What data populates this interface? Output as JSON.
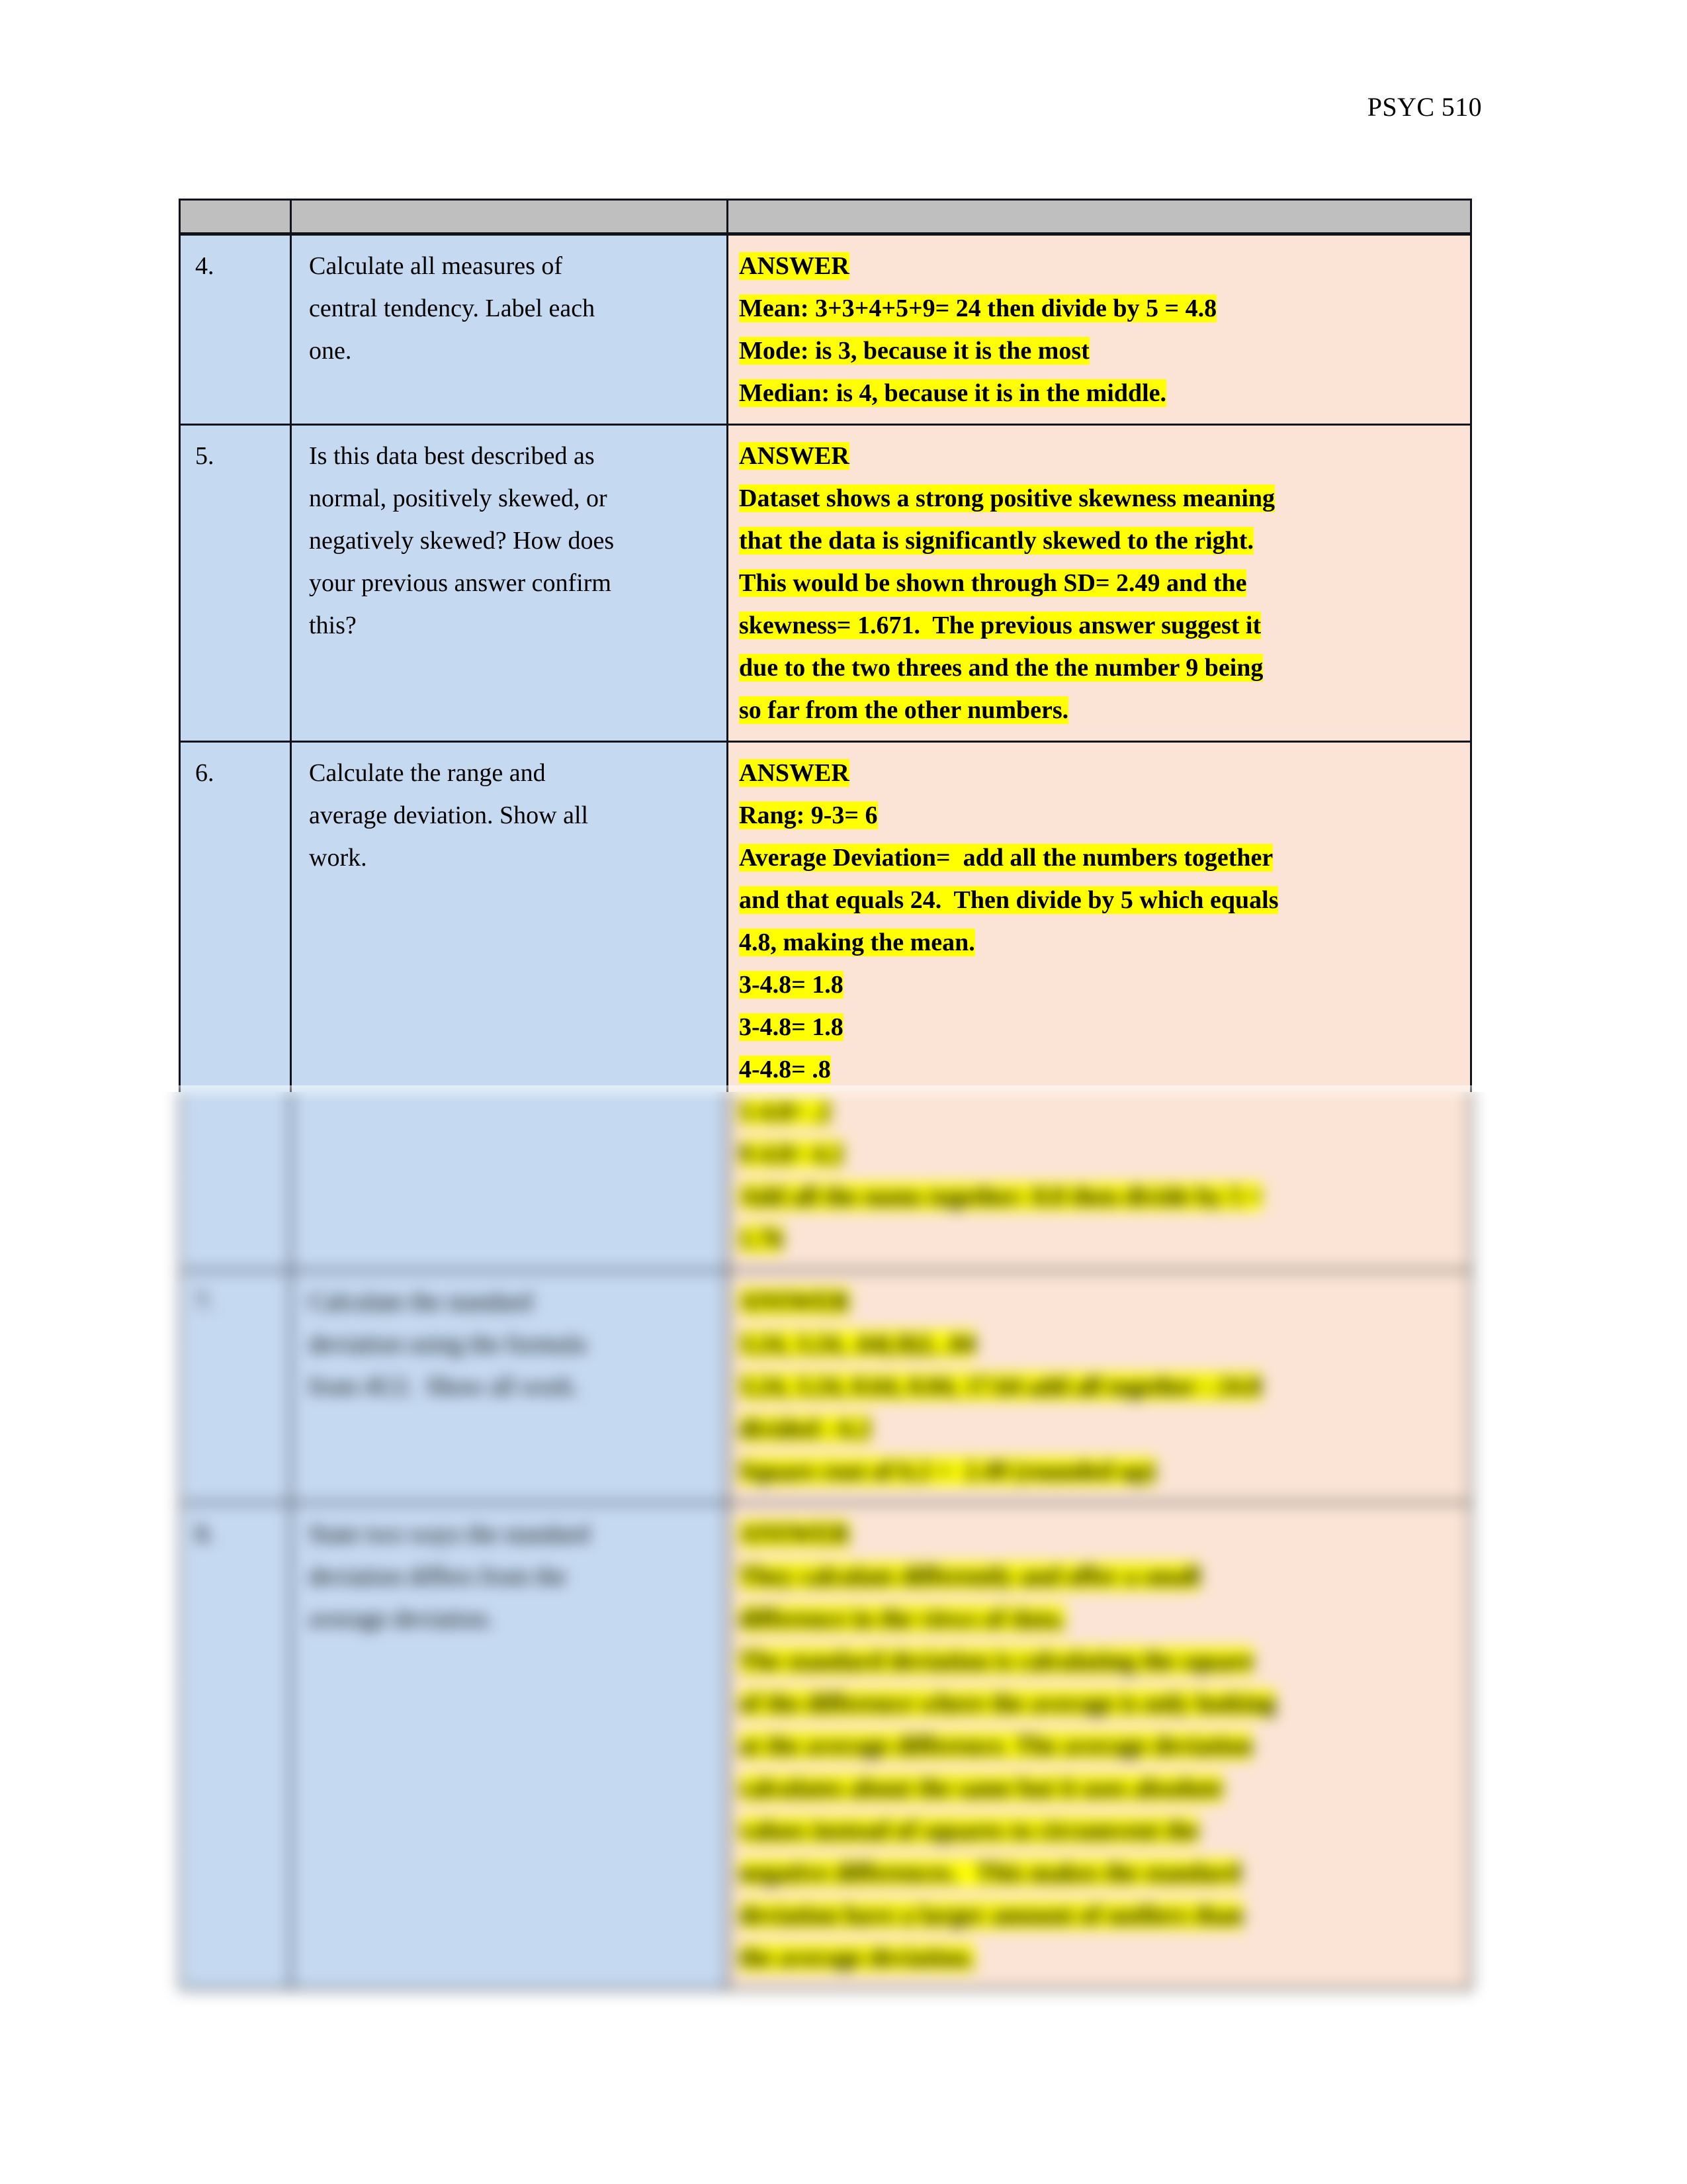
{
  "document": {
    "course_header": "PSYC 510"
  },
  "table": {
    "header_strip": "",
    "rows": [
      {
        "number": "4.",
        "question": [
          "Calculate all measures of",
          "central tendency. Label each",
          "one."
        ],
        "answer": [
          {
            "text": "ANSWER",
            "highlight": true
          },
          {
            "text": "Mean: 3+3+4+5+9= 24 then divide by 5 = 4.8",
            "highlight": true
          },
          {
            "text": "Mode: is 3, because it is the most",
            "highlight": true
          },
          {
            "text": "Median: is 4, because it is in the middle.",
            "highlight": true
          }
        ],
        "blurred": false
      },
      {
        "number": "5.",
        "question": [
          "Is this data best described as",
          "normal, positively skewed, or",
          "negatively skewed? How does",
          "your previous answer confirm",
          "this?"
        ],
        "answer": [
          {
            "text": "ANSWER",
            "highlight": true
          },
          {
            "text": "Dataset shows a strong positive skewness meaning",
            "highlight": true
          },
          {
            "text": "that the data is significantly skewed to the right.",
            "highlight": true
          },
          {
            "text": "This would be shown through SD= 2.49 and the",
            "highlight": true
          },
          {
            "text": "skewness= 1.671.  The previous answer suggest it",
            "highlight": true
          },
          {
            "text": "due to the two threes and the the number 9 being",
            "highlight": true
          },
          {
            "text": "so far from the other numbers.",
            "highlight": true
          }
        ],
        "blurred": false
      },
      {
        "number": "6.",
        "question": [
          "Calculate the range and",
          "average deviation. Show all",
          "work."
        ],
        "answer": [
          {
            "text": "ANSWER",
            "highlight": true
          },
          {
            "text": "Rang: 9-3= 6",
            "highlight": true
          },
          {
            "text": "Average Deviation=  add all the numbers together",
            "highlight": true
          },
          {
            "text": "and that equals 24.  Then divide by 5 which equals",
            "highlight": true
          },
          {
            "text": "4.8, making the mean.",
            "highlight": true
          },
          {
            "text": "3-4.8= 1.8",
            "highlight": true
          },
          {
            "text": "3-4.8= 1.8",
            "highlight": true
          },
          {
            "text": "4-4.8= .8",
            "highlight": true
          },
          {
            "text": "5-4.8= .2",
            "highlight": true
          },
          {
            "text": "9-4.8= 4.2",
            "highlight": true
          },
          {
            "text": "Add all the nums together: 8.8 then divide by 5 =",
            "highlight": true
          },
          {
            "text": "1.76",
            "highlight": true
          }
        ],
        "blurred": true
      },
      {
        "number": "7.",
        "question": [
          "Calculate the standard",
          "deviation using the formula",
          "from 4U2.  Show all work."
        ],
        "answer": [
          {
            "text": "ANSWER",
            "highlight": true
          },
          {
            "text": "3.24, 3.24, .64(.8)2, .04",
            "highlight": true
          },
          {
            "text": "3.24, 3.24, 0.64, 0.04, 17.64 add all together : 24.8",
            "highlight": true
          },
          {
            "text": "divided : 6.2",
            "highlight": true
          },
          {
            "text": "Square root of 6.2 =  2.49 (rounded up)",
            "highlight": true
          }
        ],
        "blurred": true
      },
      {
        "number": "8.",
        "question": [
          "State two ways the standard",
          "deviation differs from the",
          "average deviation."
        ],
        "answer": [
          {
            "text": "ANSWER",
            "highlight": true
          },
          {
            "text": "They calculate differently and offer a small",
            "highlight": true
          },
          {
            "text": "difference in the views of data.",
            "highlight": true
          },
          {
            "text": "The standard deviation is calculating the square",
            "highlight": true
          },
          {
            "text": "of the difference where the average is only looking",
            "highlight": true
          },
          {
            "text": "at the average difference. The average deviation",
            "highlight": true
          },
          {
            "text": "calculates about the same but it uses absolute",
            "highlight": true
          },
          {
            "text": "values instead of squares to circumvent the",
            "highlight": true
          },
          {
            "text": "negative differences.   This makes the standard",
            "highlight": true
          },
          {
            "text": "deviation have a larger amount of outliers than",
            "highlight": true
          },
          {
            "text": "the average deviation.",
            "highlight": true
          }
        ],
        "blurred": true
      }
    ]
  },
  "colors": {
    "question_cell": "#c5d9f1",
    "answer_cell": "#fbe4d5",
    "header_strip": "#bfbfbf",
    "highlight": "#ffff00",
    "border": "#10131c"
  }
}
